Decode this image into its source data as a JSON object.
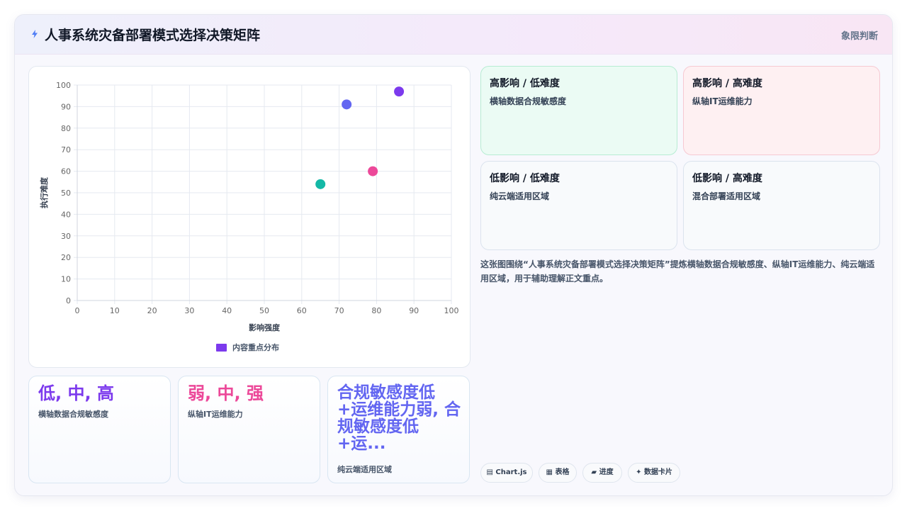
{
  "header": {
    "title": "人事系统灾备部署模式选择决策矩阵",
    "right_label": "象限判断",
    "icon": "lightning-icon"
  },
  "chart_data": {
    "type": "scatter",
    "xlabel": "影响强度",
    "ylabel": "执行难度",
    "xlim": [
      0,
      100
    ],
    "ylim": [
      0,
      100
    ],
    "x_ticks": [
      "0",
      "10",
      "20",
      "30",
      "40",
      "50",
      "60",
      "70",
      "80",
      "90",
      "100"
    ],
    "y_ticks": [
      "0",
      "10",
      "20",
      "30",
      "40",
      "50",
      "60",
      "70",
      "80",
      "90",
      "100"
    ],
    "grid": true,
    "legend": "bottom",
    "series": [
      {
        "name": "内容重点分布",
        "color": "#7c3aed",
        "points": [
          {
            "x": 72,
            "y": 91,
            "color": "#6366f1"
          },
          {
            "x": 86,
            "y": 97,
            "color": "#7c3aed"
          },
          {
            "x": 79,
            "y": 60,
            "color": "#ec4899"
          },
          {
            "x": 65,
            "y": 54,
            "color": "#14b8a6"
          }
        ]
      }
    ]
  },
  "stats": [
    {
      "value": "低, 中, 高",
      "label": "横轴数据合规敏感度",
      "color": "#7c3aed"
    },
    {
      "value": "弱, 中, 强",
      "label": "纵轴IT运维能力",
      "color": "#ec4899"
    },
    {
      "value": "合规敏感度低+运维能力弱, 合规敏感度低+运...",
      "label": "纯云端适用区域",
      "color": "#6366f1"
    }
  ],
  "quadrants": [
    {
      "title": "高影响 / 低难度",
      "subtitle": "横轴数据合规敏感度",
      "bg": "#ebfbf4",
      "border": "#b7ecd3"
    },
    {
      "title": "高影响 / 高难度",
      "subtitle": "纵轴IT运维能力",
      "bg": "#fef0f2",
      "border": "#f6c9d2"
    },
    {
      "title": "低影响 / 低难度",
      "subtitle": "纯云端适用区域",
      "bg": "#f8fafc",
      "border": "#dbe3ee"
    },
    {
      "title": "低影响 / 高难度",
      "subtitle": "混合部署适用区域",
      "bg": "#f8fafc",
      "border": "#dbe3ee"
    }
  ],
  "description": "这张图围绕“人事系统灾备部署模式选择决策矩阵”提炼横轴数据合规敏感度、纵轴IT运维能力、纯云端适用区域，用于辅助理解正文重点。",
  "tags": [
    {
      "icon": "chart-icon",
      "label": "Chart.js"
    },
    {
      "icon": "table-icon",
      "label": "表格"
    },
    {
      "icon": "progress-icon",
      "label": "进度"
    },
    {
      "icon": "sparkle-icon",
      "label": "数据卡片"
    }
  ]
}
